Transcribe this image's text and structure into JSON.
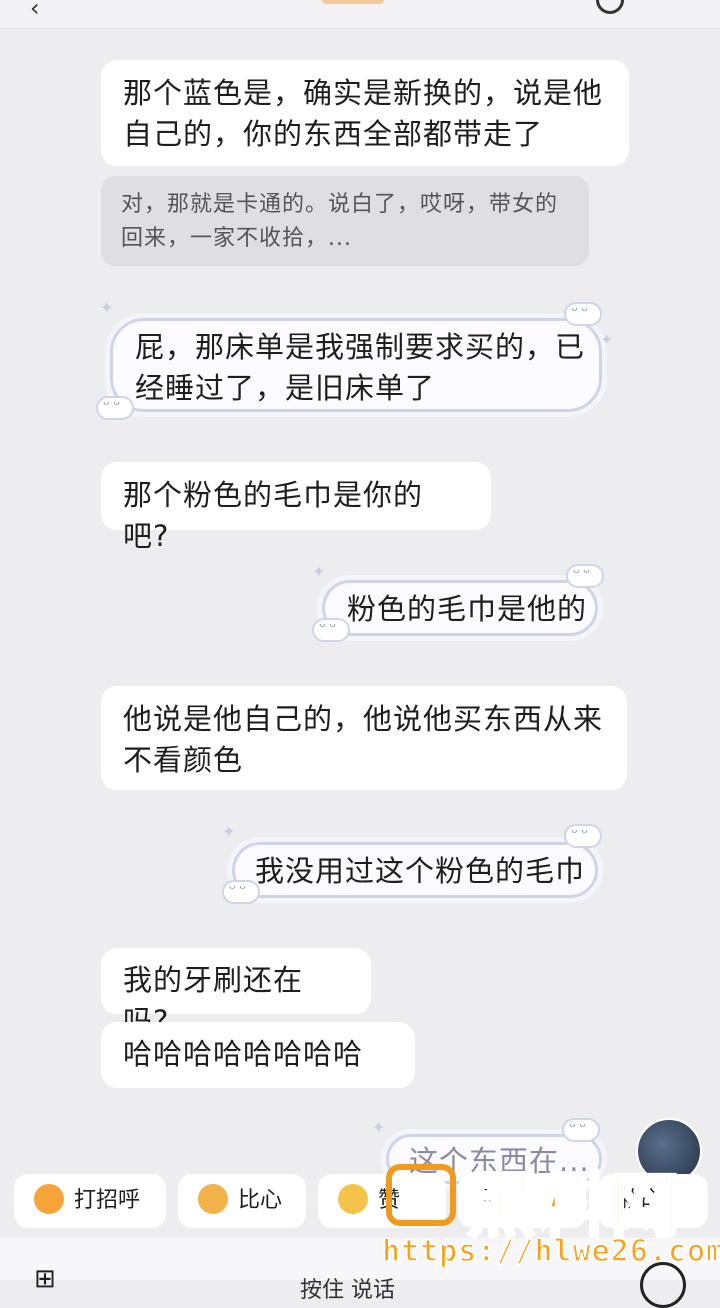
{
  "messages": {
    "m1": "那个蓝色是，确实是新换的，说是他自己的，你的东西全部都带走了",
    "quote": "对，那就是卡通的。说白了，哎呀，带女的回来，一家不收拾，...",
    "s1": "屁，那床单是我强制要求买的，已经睡过了，是旧床单了",
    "m2": "那个粉色的毛巾是你的吧?",
    "s2": "粉色的毛巾是他的",
    "m3": "他说是他自己的，他说他买东西从来不看颜色",
    "s3": "我没用过这个粉色的毛巾",
    "m4": "我的牙刷还在吗?",
    "m5": "哈哈哈哈哈哈哈哈",
    "s4": "这个东西在..."
  },
  "quick_replies": [
    "打招呼",
    "比心",
    "赞",
    "晕",
    "救命"
  ],
  "input": {
    "placeholder": "按住 说话"
  },
  "watermark": {
    "brand": "黑料网",
    "url": "https://hlwe26.com"
  },
  "colors": {
    "background": "#ededf0",
    "bubble": "#ffffff",
    "sticker_border": "#cfd4e8",
    "watermark": "#f7a21c"
  }
}
